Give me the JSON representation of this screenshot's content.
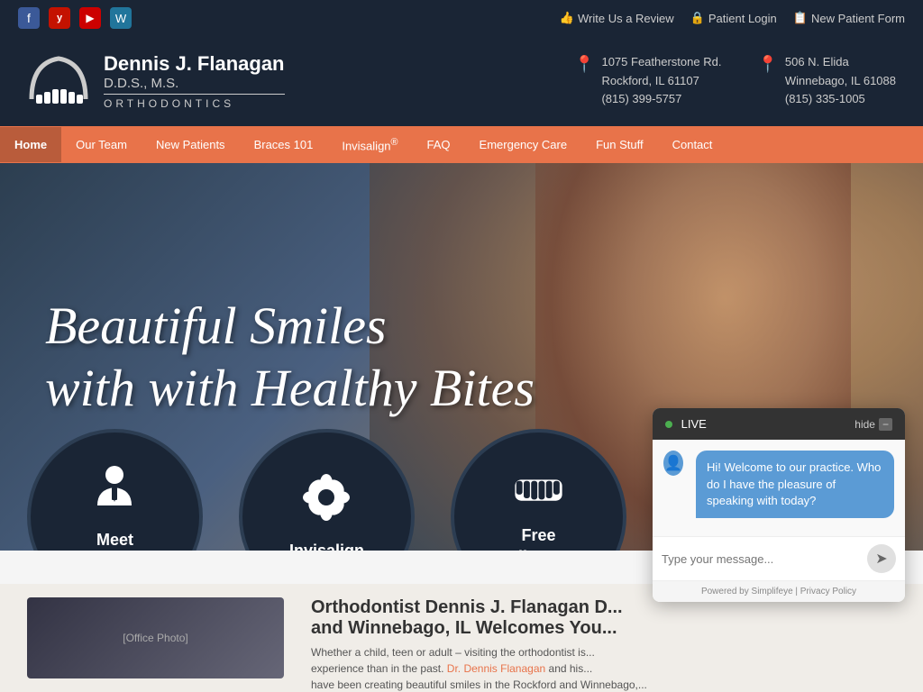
{
  "topbar": {
    "social": [
      {
        "name": "facebook",
        "label": "f",
        "class": "fb"
      },
      {
        "name": "yelp",
        "label": "y",
        "class": "yelp"
      },
      {
        "name": "youtube",
        "label": "▶",
        "class": "yt"
      },
      {
        "name": "wordpress",
        "label": "W",
        "class": "wp"
      }
    ],
    "links": [
      {
        "label": "Write Us a Review",
        "icon": "👍",
        "href": "#"
      },
      {
        "label": "Patient Login",
        "icon": "🔒",
        "href": "#"
      },
      {
        "label": "New Patient Form",
        "icon": "📋",
        "href": "#"
      }
    ]
  },
  "header": {
    "logo": {
      "name": "Dennis J. Flanagan",
      "credentials": "D.D.S., M.S.",
      "specialty": "ORTHODONTICS"
    },
    "addresses": [
      {
        "line1": "1075 Featherstone Rd.",
        "line2": "Rockford, IL 61107",
        "phone": "(815) 399-5757"
      },
      {
        "line1": "506 N. Elida",
        "line2": "Winnebago, IL 61088",
        "phone": "(815) 335-1005"
      }
    ]
  },
  "nav": {
    "items": [
      {
        "label": "Home",
        "active": true
      },
      {
        "label": "Our Team",
        "active": false
      },
      {
        "label": "New Patients",
        "active": false
      },
      {
        "label": "Braces 101",
        "active": false
      },
      {
        "label": "Invisalign®",
        "active": false
      },
      {
        "label": "FAQ",
        "active": false
      },
      {
        "label": "Emergency Care",
        "active": false
      },
      {
        "label": "Fun Stuff",
        "active": false
      },
      {
        "label": "Contact",
        "active": false
      }
    ]
  },
  "hero": {
    "headline_line1": "Beautiful Smiles",
    "headline_line2": "with Healthy Bites"
  },
  "circles": [
    {
      "label": "Meet\nDr. Flanagan",
      "icon": "👤"
    },
    {
      "label": "Invisalign",
      "icon": "✿"
    },
    {
      "label": "Free\nSmile Exam",
      "icon": "😁"
    }
  ],
  "bottom": {
    "heading": "Orthodontist Dennis J. Flanagan D",
    "heading2": "and Winnebago, IL Welcomes You",
    "body1": "Whether a child, teen or adult – visiting the orthodontist is",
    "body2": "experience than in the past.",
    "link_text": "Dr. Dennis Flanagan",
    "body3": "and his",
    "body4": "have been creating beautiful smiles in the Rockford and Winnebago,"
  },
  "chat": {
    "live_label": "LIVE",
    "hide_label": "hide",
    "minimize_icon": "−",
    "bubble": "Hi! Welcome to our practice.  Who do I have the pleasure of speaking with today?",
    "input_placeholder": "Type your message...",
    "send_icon": "➤",
    "footer": "Powered by Simplifeye | Privacy Policy"
  }
}
